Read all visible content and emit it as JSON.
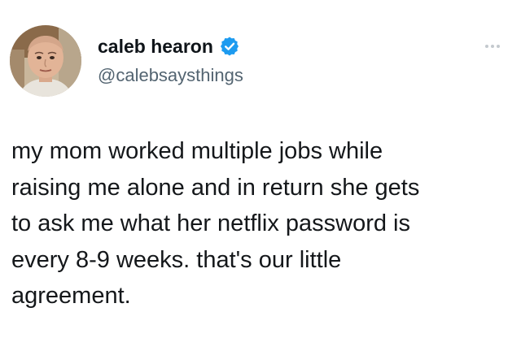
{
  "author": {
    "display_name": "caleb hearon",
    "handle": "@calebsaysthings",
    "verified": true,
    "avatar_alt": "avatar"
  },
  "tweet": {
    "lines": [
      "my mom worked multiple jobs while",
      "raising me alone and in return she gets",
      "to ask me what her netflix password is",
      "every 8-9 weeks. that's our little",
      "agreement."
    ]
  },
  "icons": {
    "verified": "verified-badge-icon",
    "more": "more-options-icon"
  },
  "colors": {
    "verified_blue": "#1d9bf0",
    "handle_gray": "#536471",
    "text": "#14171a"
  }
}
